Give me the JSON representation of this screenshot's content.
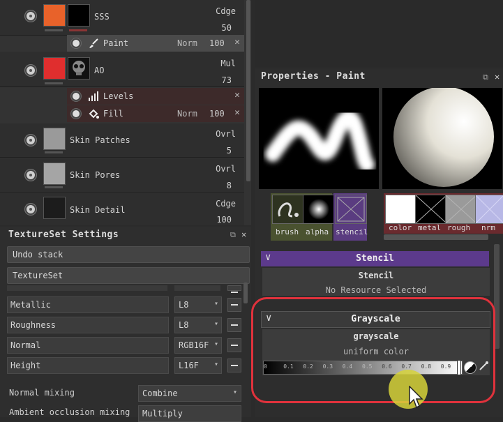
{
  "layers": [
    {
      "name": "SSS",
      "blend": "Cdge",
      "opacity": "50"
    },
    {
      "name": "AO",
      "blend": "Mul",
      "opacity": "73"
    },
    {
      "name": "Skin Patches",
      "blend": "Ovrl",
      "opacity": "5"
    },
    {
      "name": "Skin Pores",
      "blend": "Ovrl",
      "opacity": "8"
    },
    {
      "name": "Skin Detail",
      "blend": "Cdge",
      "opacity": "100"
    }
  ],
  "sub_layers": {
    "paint": {
      "label": "Paint",
      "blend": "Norm",
      "opacity": "100",
      "close": "✕"
    },
    "levels": {
      "label": "Levels",
      "close": "✕"
    },
    "fill": {
      "label": "Fill",
      "blend": "Norm",
      "opacity": "100",
      "close": "✕"
    }
  },
  "texture_set": {
    "title": "TextureSet Settings",
    "undo_stack": "Undo stack",
    "textureset_button": "TextureSet",
    "channels": [
      {
        "name": "Metallic",
        "format": "L8"
      },
      {
        "name": "Roughness",
        "format": "L8"
      },
      {
        "name": "Normal",
        "format": "RGB16F"
      },
      {
        "name": "Height",
        "format": "L16F"
      }
    ],
    "normal_mixing_label": "Normal mixing",
    "normal_mixing_value": "Combine",
    "ao_mixing_label": "Ambient occlusion mixing",
    "ao_mixing_value": "Multiply",
    "icons": {
      "float": "⧉",
      "close": "✕"
    }
  },
  "properties": {
    "title": "Properties - Paint",
    "icons": {
      "float": "⧉",
      "close": "✕"
    },
    "tool_slots": [
      "brush",
      "alpha",
      "stencil"
    ],
    "material_slots": [
      "color",
      "metal",
      "rough",
      "nrm"
    ],
    "stencil": {
      "section_title": "Stencil",
      "card_title": "Stencil",
      "status": "No Resource Selected"
    },
    "grayscale": {
      "section_title": "Grayscale",
      "card_title": "grayscale",
      "mode": "uniform color",
      "ticks": [
        "0",
        "0.1",
        "0.2",
        "0.3",
        "0.4",
        "0.5",
        "0.6",
        "0.7",
        "0.8",
        "0.9",
        "1"
      ],
      "value": 1.0
    }
  },
  "colors": {
    "stencil_header": "#5c3a8c",
    "highlight_ring": "#e0323c",
    "cursor_highlight": "#d6d23a",
    "sss_thumb": "#e8622a",
    "ao_thumb": "#e02e2e"
  }
}
